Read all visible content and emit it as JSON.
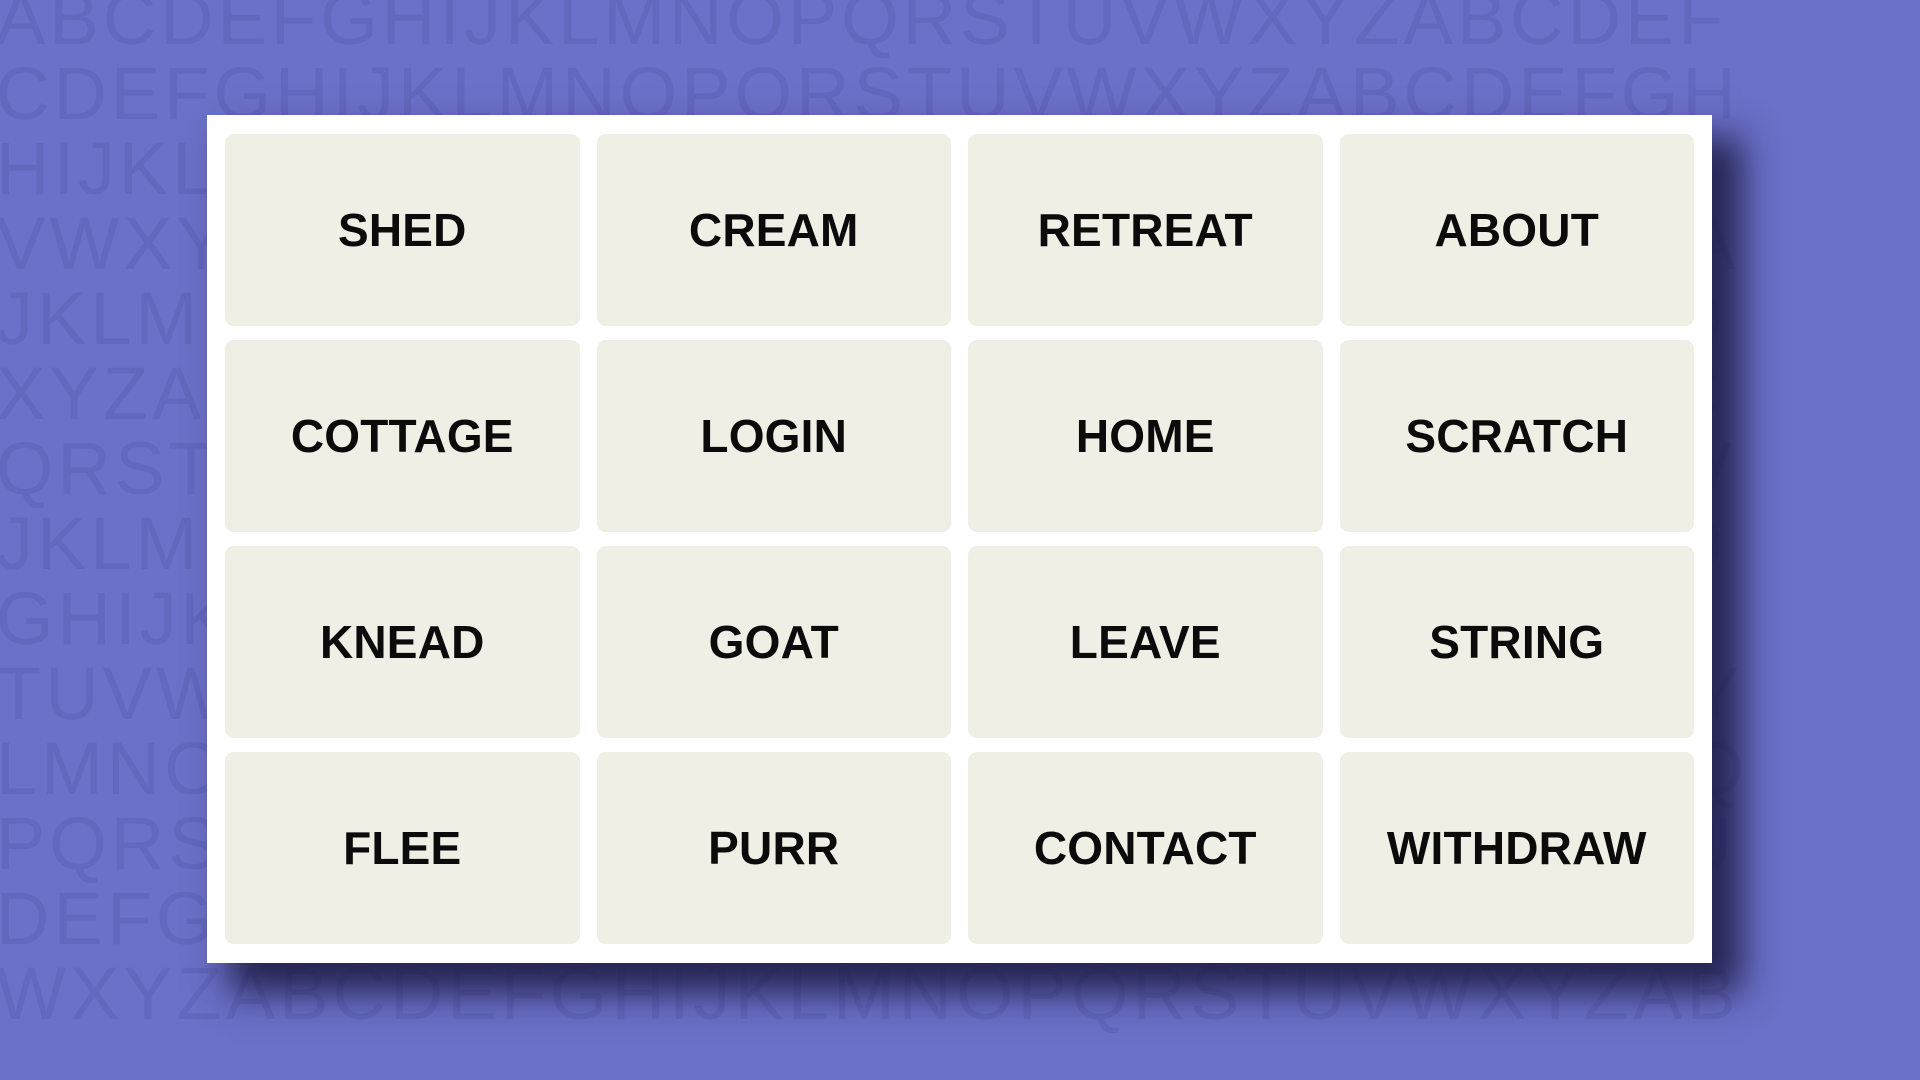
{
  "page": {
    "title": "Word Grouping Puzzle Board",
    "background_color": "#6b70c8",
    "card_color": "#ffffff",
    "tile_color": "#efefe6",
    "tile_text_color": "#0b0b0b",
    "pattern_letter_color": "#6367bd",
    "shadow_color": "#161438"
  },
  "background_pattern": {
    "name": "alphabet-tiling",
    "rows": [
      "ABCDEFGHIJKLMNOPQRSTUVWXYZABCDEF",
      "CDEFGHIJKLMNOPQRSTUVWXYZABCDEFGH",
      "HIJKLMNOPQRSTUVWXYZABCDEFGHIJKLM",
      "VWXYZABCDEFGHIJKLMNOPQRSTUVWXYZA",
      "JKLMNOPQRSTUVWXYZABCDEFGHIJKLMNO",
      "XYZABCDEFGHIJKLMNOPQRSTUVWXYZABC",
      "QRSTUVWXYZABCDEFGHIJKLMNOPQRSTUV",
      "JKLMNOPQRSTUVWXYZABCDEFGHIJKLMNO",
      "GHIJKLMNOPQRSTUVWXYZABCDEFGHIJKL",
      "TUVWXYZABCDEFGHIJKLMNOPQRSTUVWXY",
      "LMNOPQRSTUVWXYZABCDEFGHIJKLMNOPQ",
      "PQRSTUVWXYZABCDEFGHIJKLMNOPQRSTU",
      "DEFGHIJKLMNOPQRSTUVWXYZABCDEFGHI",
      "WXYZABCDEFGHIJKLMNOPQRSTUVWXYZAB"
    ]
  },
  "board": {
    "rows": 4,
    "columns": 4,
    "tiles": [
      {
        "label": "SHED"
      },
      {
        "label": "CREAM"
      },
      {
        "label": "RETREAT"
      },
      {
        "label": "ABOUT"
      },
      {
        "label": "COTTAGE"
      },
      {
        "label": "LOGIN"
      },
      {
        "label": "HOME"
      },
      {
        "label": "SCRATCH"
      },
      {
        "label": "KNEAD"
      },
      {
        "label": "GOAT"
      },
      {
        "label": "LEAVE"
      },
      {
        "label": "STRING"
      },
      {
        "label": "FLEE"
      },
      {
        "label": "PURR"
      },
      {
        "label": "CONTACT"
      },
      {
        "label": "WITHDRAW"
      }
    ]
  }
}
